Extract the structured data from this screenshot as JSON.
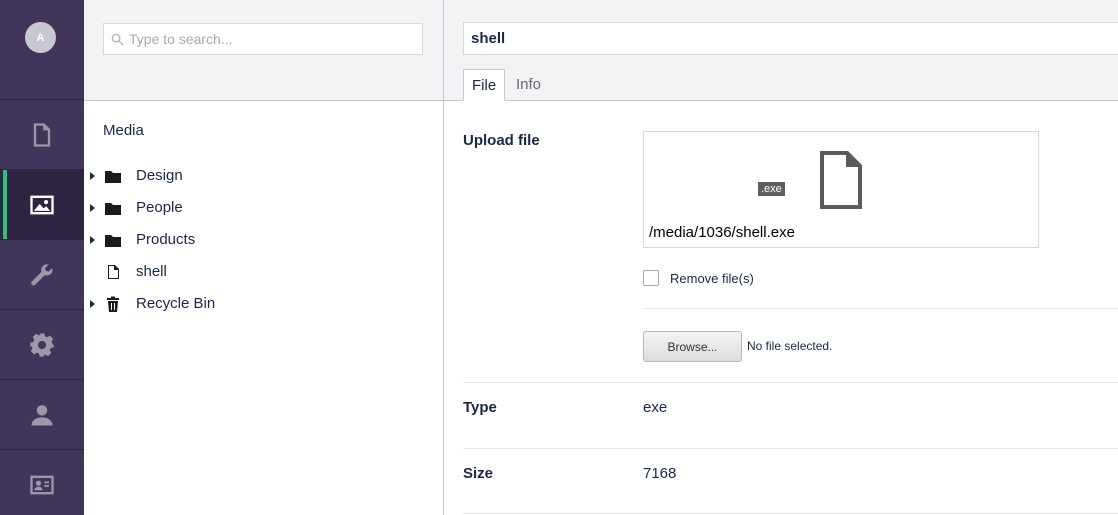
{
  "user": {
    "initial": "A"
  },
  "nav": {
    "items": [
      {
        "name": "content",
        "icon": "document-icon",
        "active": false
      },
      {
        "name": "media",
        "icon": "image-icon",
        "active": true
      },
      {
        "name": "settings",
        "icon": "wrench-icon",
        "active": false
      },
      {
        "name": "packages",
        "icon": "gear-icon",
        "active": false
      },
      {
        "name": "users",
        "icon": "user-icon",
        "active": false
      },
      {
        "name": "members",
        "icon": "id-card-icon",
        "active": false
      }
    ]
  },
  "search": {
    "placeholder": "Type to search..."
  },
  "tree": {
    "root_label": "Media",
    "items": [
      {
        "label": "Design",
        "icon": "folder-icon",
        "has_children": true
      },
      {
        "label": "People",
        "icon": "folder-icon",
        "has_children": true
      },
      {
        "label": "Products",
        "icon": "folder-icon",
        "has_children": true
      },
      {
        "label": "shell",
        "icon": "file-icon",
        "has_children": false
      },
      {
        "label": "Recycle Bin",
        "icon": "trash-icon",
        "has_children": true
      }
    ]
  },
  "editor": {
    "name": "shell",
    "tabs": {
      "file": "File",
      "info": "Info"
    },
    "upload": {
      "label": "Upload file",
      "extension": ".exe",
      "path": "/media/1036/shell.exe",
      "remove_label": "Remove file(s)",
      "browse_label": "Browse...",
      "no_file_text": "No file selected."
    },
    "type": {
      "label": "Type",
      "value": "exe"
    },
    "size": {
      "label": "Size",
      "value": "7168"
    }
  },
  "colors": {
    "rail": "#413659",
    "rail_active": "#2e2543",
    "accent": "#2bc37c",
    "text": "#1b264f"
  }
}
